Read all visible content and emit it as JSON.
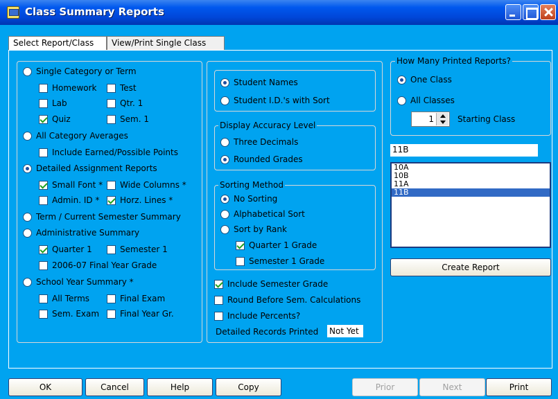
{
  "window": {
    "title": "Class Summary Reports"
  },
  "tabs": [
    {
      "label": "Select Report/Class",
      "active": true
    },
    {
      "label": "View/Print Single Class",
      "active": false
    }
  ],
  "left_panel": {
    "single_category": {
      "label": "Single Category or Term",
      "checked": false
    },
    "homework": {
      "label": "Homework",
      "checked": false
    },
    "test": {
      "label": "Test",
      "checked": false
    },
    "lab": {
      "label": "Lab",
      "checked": false
    },
    "qtr1": {
      "label": "Qtr. 1",
      "checked": false
    },
    "quiz": {
      "label": "Quiz",
      "checked": true
    },
    "sem1": {
      "label": "Sem. 1",
      "checked": false
    },
    "all_category": {
      "label": "All Category Averages",
      "checked": false
    },
    "include_earned": {
      "label": "Include Earned/Possible Points",
      "checked": false
    },
    "detailed": {
      "label": "Detailed Assignment Reports",
      "checked": true
    },
    "small_font": {
      "label": "Small Font *",
      "checked": true
    },
    "wide_columns": {
      "label": "Wide Columns *",
      "checked": false
    },
    "admin_id": {
      "label": "Admin. ID *",
      "checked": false
    },
    "horz_lines": {
      "label": "Horz. Lines *",
      "checked": true
    },
    "term_summary": {
      "label": "Term / Current Semester Summary",
      "checked": false
    },
    "admin_summary": {
      "label": "Administrative Summary",
      "checked": false
    },
    "quarter1": {
      "label": "Quarter 1",
      "checked": true
    },
    "semester1": {
      "label": "Semester 1",
      "checked": false
    },
    "final_year": {
      "label": "2006-07 Final Year Grade",
      "checked": false
    },
    "school_year": {
      "label": "School Year Summary *",
      "checked": false
    },
    "all_terms": {
      "label": "All Terms",
      "checked": false
    },
    "final_exam": {
      "label": "Final Exam",
      "checked": false
    },
    "sem_exam": {
      "label": "Sem. Exam",
      "checked": false
    },
    "final_year_gr": {
      "label": "Final Year Gr.",
      "checked": false
    }
  },
  "middle_panel": {
    "student_names": {
      "label": "Student Names",
      "checked": true
    },
    "student_ids": {
      "label": "Student I.D.'s with Sort",
      "checked": false
    },
    "accuracy_legend": "Display Accuracy Level",
    "three_decimals": {
      "label": "Three Decimals",
      "checked": false
    },
    "rounded": {
      "label": "Rounded Grades",
      "checked": true
    },
    "sorting_legend": "Sorting Method",
    "no_sorting": {
      "label": "No Sorting",
      "checked": true
    },
    "alpha_sort": {
      "label": "Alphabetical Sort",
      "checked": false
    },
    "sort_rank": {
      "label": "Sort by Rank",
      "checked": false
    },
    "q1_grade": {
      "label": "Quarter 1 Grade",
      "checked": true
    },
    "s1_grade": {
      "label": "Semester 1 Grade",
      "checked": false
    },
    "include_sem": {
      "label": "Include Semester Grade",
      "checked": true
    },
    "round_before": {
      "label": "Round Before Sem. Calculations",
      "checked": false
    },
    "include_percents": {
      "label": "Include Percents?",
      "checked": false
    },
    "records_label": "Detailed Records Printed",
    "records_value": "Not Yet"
  },
  "right_panel": {
    "legend": "How Many Printed Reports?",
    "one_class": {
      "label": "One Class",
      "checked": true
    },
    "all_classes": {
      "label": "All Classes",
      "checked": false
    },
    "starting_value": "1",
    "starting_label": "Starting Class",
    "selected_class": "11B",
    "classes": [
      {
        "label": "10A",
        "selected": false
      },
      {
        "label": "10B",
        "selected": false
      },
      {
        "label": "11A",
        "selected": false
      },
      {
        "label": "11B",
        "selected": true
      }
    ],
    "create_report": "Create Report"
  },
  "buttons": {
    "ok": "OK",
    "cancel": "Cancel",
    "help": "Help",
    "copy": "Copy",
    "prior": "Prior",
    "next": "Next",
    "print": "Print"
  }
}
